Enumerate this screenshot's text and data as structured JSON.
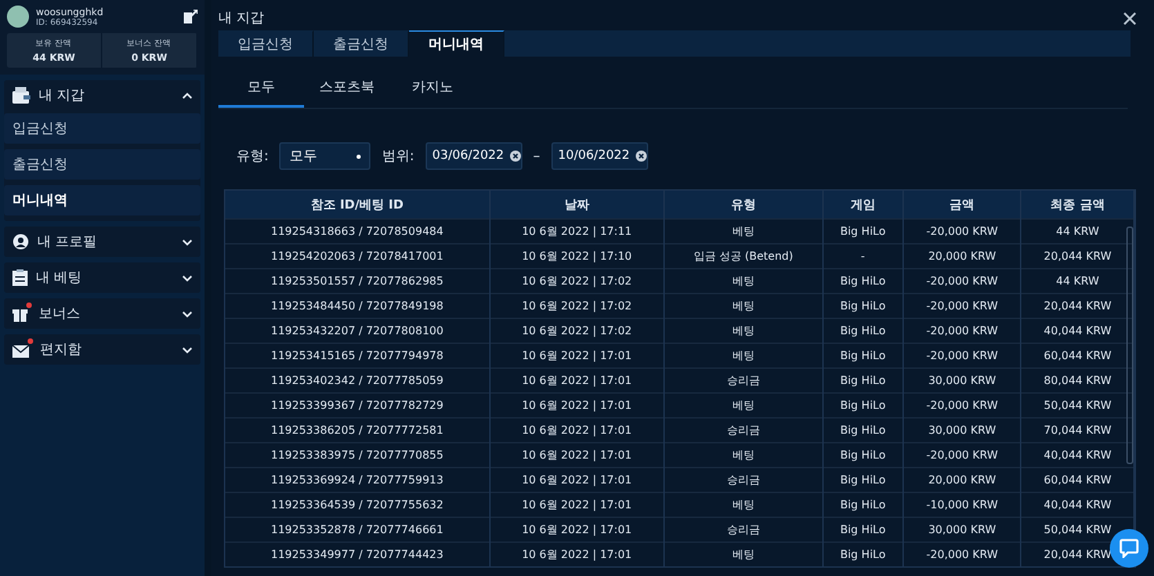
{
  "sidebar": {
    "user": {
      "name": "woosungghkd",
      "id": "ID: 669432594"
    },
    "balances": [
      {
        "label": "보유 잔액",
        "value": "44 KRW"
      },
      {
        "label": "보너스 잔액",
        "value": "0 KRW"
      }
    ],
    "menu": [
      {
        "label": "내 지갑",
        "expanded": true,
        "notification": false,
        "children": [
          {
            "label": "입금신청",
            "selected": false
          },
          {
            "label": "출금신청",
            "selected": false
          },
          {
            "label": "머니내역",
            "selected": true
          }
        ]
      },
      {
        "label": "내 프로필",
        "expanded": false,
        "notification": false
      },
      {
        "label": "내 베팅",
        "expanded": false,
        "notification": false
      },
      {
        "label": "보너스",
        "expanded": false,
        "notification": true
      },
      {
        "label": "편지함",
        "expanded": false,
        "notification": true
      }
    ]
  },
  "panel": {
    "title": "내 지갑",
    "tabs": [
      {
        "label": "입금신청",
        "selected": false
      },
      {
        "label": "출금신청",
        "selected": false
      },
      {
        "label": "머니내역",
        "selected": true
      }
    ],
    "subtabs": [
      {
        "label": "모두",
        "selected": true
      },
      {
        "label": "스포츠북",
        "selected": false
      },
      {
        "label": "카지노",
        "selected": false
      }
    ],
    "filter": {
      "type_label": "유형:",
      "type_value": "모두",
      "range_label": "범위:",
      "from": "03/06/2022",
      "separator": "–",
      "to": "10/06/2022"
    },
    "table": {
      "columns": [
        "참조 ID/베팅 ID",
        "날짜",
        "유형",
        "게임",
        "금액",
        "최종 금액"
      ],
      "rows": [
        [
          "119254318663 / 72078509484",
          "10 6월 2022 | 17:11",
          "베팅",
          "Big HiLo",
          "-20,000 KRW",
          "44 KRW"
        ],
        [
          "119254202063 / 72078417001",
          "10 6월 2022 | 17:10",
          "입금 성공 (Betend)",
          "-",
          "20,000 KRW",
          "20,044 KRW"
        ],
        [
          "119253501557 / 72077862985",
          "10 6월 2022 | 17:02",
          "베팅",
          "Big HiLo",
          "-20,000 KRW",
          "44 KRW"
        ],
        [
          "119253484450 / 72077849198",
          "10 6월 2022 | 17:02",
          "베팅",
          "Big HiLo",
          "-20,000 KRW",
          "20,044 KRW"
        ],
        [
          "119253432207 / 72077808100",
          "10 6월 2022 | 17:02",
          "베팅",
          "Big HiLo",
          "-20,000 KRW",
          "40,044 KRW"
        ],
        [
          "119253415165 / 72077794978",
          "10 6월 2022 | 17:01",
          "베팅",
          "Big HiLo",
          "-20,000 KRW",
          "60,044 KRW"
        ],
        [
          "119253402342 / 72077785059",
          "10 6월 2022 | 17:01",
          "승리금",
          "Big HiLo",
          "30,000 KRW",
          "80,044 KRW"
        ],
        [
          "119253399367 / 72077782729",
          "10 6월 2022 | 17:01",
          "베팅",
          "Big HiLo",
          "-20,000 KRW",
          "50,044 KRW"
        ],
        [
          "119253386205 / 72077772581",
          "10 6월 2022 | 17:01",
          "승리금",
          "Big HiLo",
          "30,000 KRW",
          "70,044 KRW"
        ],
        [
          "119253383975 / 72077770855",
          "10 6월 2022 | 17:01",
          "베팅",
          "Big HiLo",
          "-20,000 KRW",
          "40,044 KRW"
        ],
        [
          "119253369924 / 72077759913",
          "10 6월 2022 | 17:01",
          "승리금",
          "Big HiLo",
          "20,000 KRW",
          "60,044 KRW"
        ],
        [
          "119253364539 / 72077755632",
          "10 6월 2022 | 17:01",
          "베팅",
          "Big HiLo",
          "-10,000 KRW",
          "40,044 KRW"
        ],
        [
          "119253352878 / 72077746661",
          "10 6월 2022 | 17:01",
          "승리금",
          "Big HiLo",
          "30,000 KRW",
          "50,044 KRW"
        ],
        [
          "119253349977 / 72077744423",
          "10 6월 2022 | 17:01",
          "베팅",
          "Big HiLo",
          "-20,000 KRW",
          "20,044 KRW"
        ]
      ]
    }
  }
}
